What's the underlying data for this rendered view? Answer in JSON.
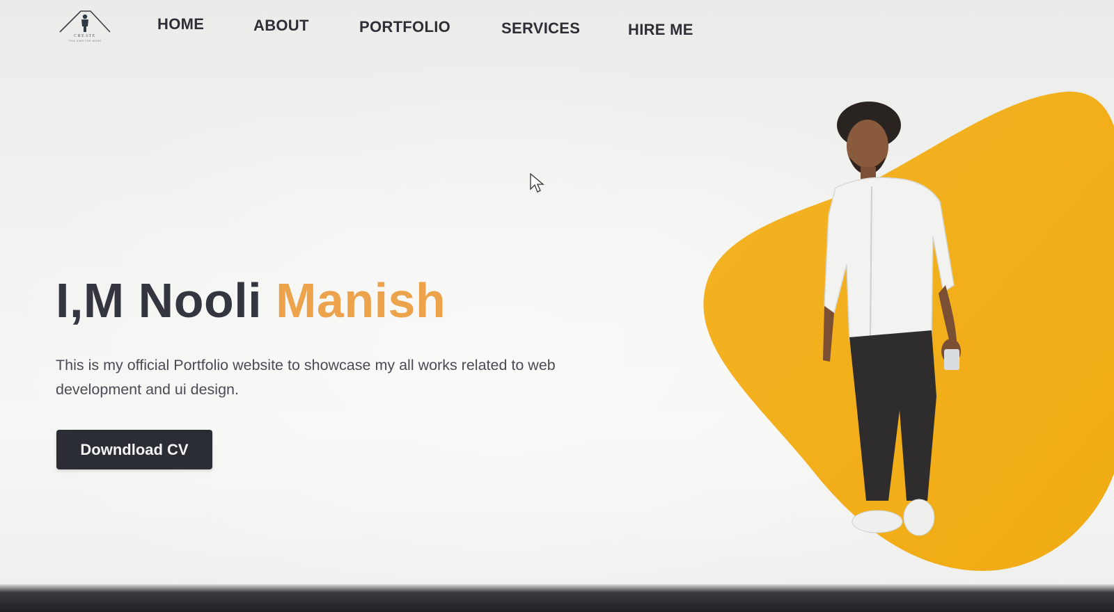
{
  "logo": {
    "name": "CREATE",
    "tagline": "THIS AIMS FOR WORK"
  },
  "nav": {
    "items": [
      {
        "label": "HOME"
      },
      {
        "label": "ABOUT"
      },
      {
        "label": "PORTFOLIO"
      },
      {
        "label": "SERVICES"
      },
      {
        "label": "HIRE ME"
      }
    ]
  },
  "hero": {
    "title_prefix": "I,M Nooli",
    "title_accent": "Manish",
    "description": "This is my official Portfolio website to showcase my all works related to web development and ui design.",
    "button_label": "Downdload CV"
  },
  "colors": {
    "accent": "#eca34b",
    "blob": "#f3b21c",
    "text_dark": "#33353f",
    "button_bg": "#2b2d35"
  },
  "icons": {
    "logo": "person-triangle-logo-icon",
    "cursor": "mouse-pointer-icon"
  }
}
